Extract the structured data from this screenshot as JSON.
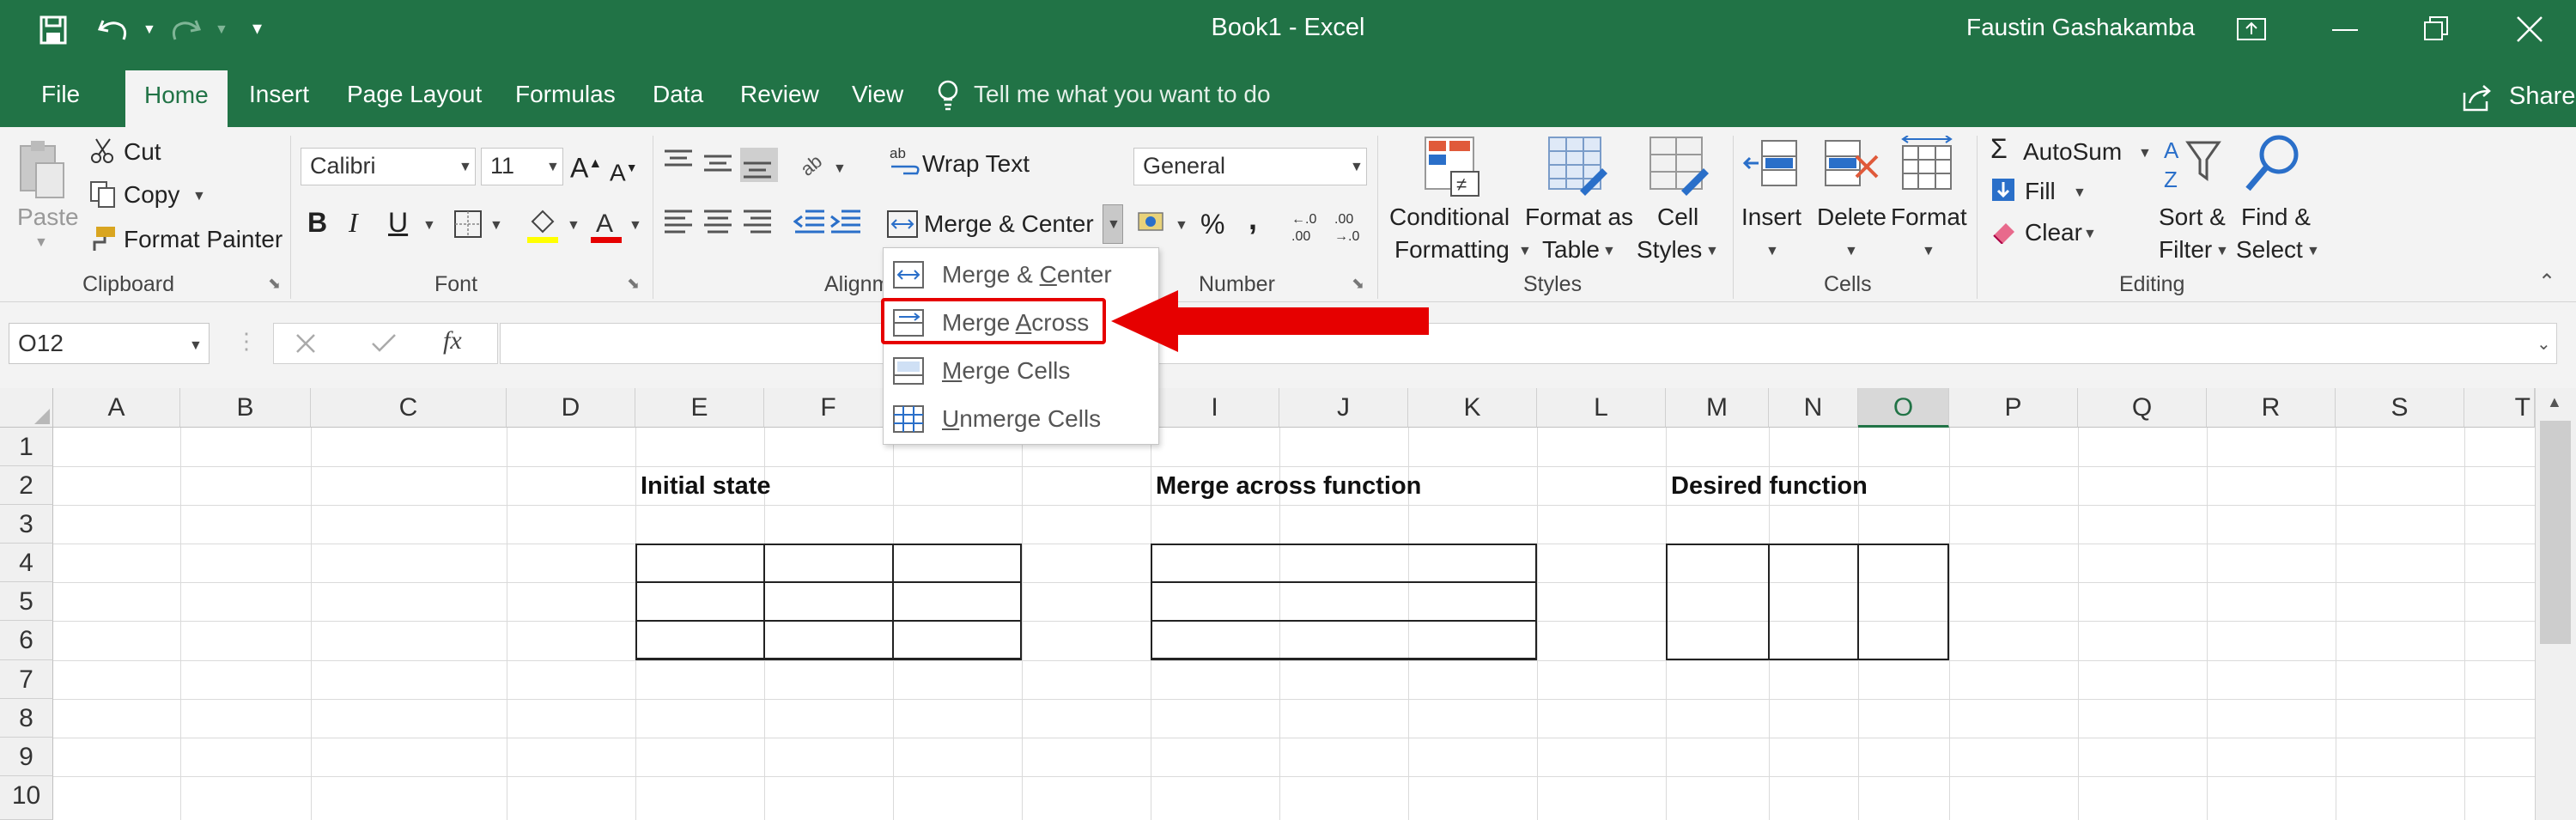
{
  "window": {
    "title": "Book1  -  Excel",
    "user": "Faustin Gashakamba",
    "share_label": "Share"
  },
  "tabs": [
    {
      "label": "File"
    },
    {
      "label": "Home"
    },
    {
      "label": "Insert"
    },
    {
      "label": "Page Layout"
    },
    {
      "label": "Formulas"
    },
    {
      "label": "Data"
    },
    {
      "label": "Review"
    },
    {
      "label": "View"
    }
  ],
  "tell_me": {
    "placeholder": "Tell me what you want to do"
  },
  "clipboard": {
    "paste": "Paste",
    "cut": "Cut",
    "copy": "Copy",
    "format_painter": "Format Painter",
    "group": "Clipboard"
  },
  "font": {
    "name": "Calibri",
    "size": "11",
    "group": "Font",
    "bold": "B",
    "italic": "I",
    "underline": "U"
  },
  "alignment": {
    "wrap_text": "Wrap Text",
    "merge_center": "Merge & Center",
    "group": "Alignm"
  },
  "number": {
    "format": "General",
    "group": "Number",
    "percent": "%",
    "comma": ","
  },
  "styles": {
    "conditional_1": "Conditional",
    "conditional_2": "Formatting",
    "format_table_1": "Format as",
    "format_table_2": "Table",
    "cell_styles_1": "Cell",
    "cell_styles_2": "Styles",
    "group": "Styles"
  },
  "cells": {
    "insert": "Insert",
    "delete": "Delete",
    "format": "Format",
    "group": "Cells"
  },
  "editing": {
    "autosum": "AutoSum",
    "fill": "Fill",
    "clear": "Clear",
    "sort_1": "Sort &",
    "sort_2": "Filter",
    "find_1": "Find &",
    "find_2": "Select",
    "group": "Editing"
  },
  "formula_bar": {
    "name_box": "O12",
    "fx": "fx",
    "value": ""
  },
  "merge_menu": {
    "items": [
      {
        "label": "Merge & Center",
        "highlighted": false
      },
      {
        "label": "Merge Across",
        "highlighted": true
      },
      {
        "label": "Merge Cells",
        "highlighted": false
      },
      {
        "label": "Unmerge Cells",
        "highlighted": false
      }
    ]
  },
  "grid": {
    "columns": [
      "A",
      "B",
      "C",
      "D",
      "E",
      "F",
      "I",
      "J",
      "K",
      "L",
      "M",
      "N",
      "O",
      "P",
      "Q",
      "R",
      "S",
      "T"
    ],
    "rows": [
      "1",
      "2",
      "3",
      "4",
      "5",
      "6",
      "7",
      "8",
      "9",
      "10"
    ],
    "selected_column": "O",
    "labels": {
      "initial": "Initial state",
      "merge_across": "Merge across function",
      "desired": "Desired function"
    }
  },
  "colors": {
    "excel_green": "#217346",
    "annotation_red": "#e60000"
  }
}
